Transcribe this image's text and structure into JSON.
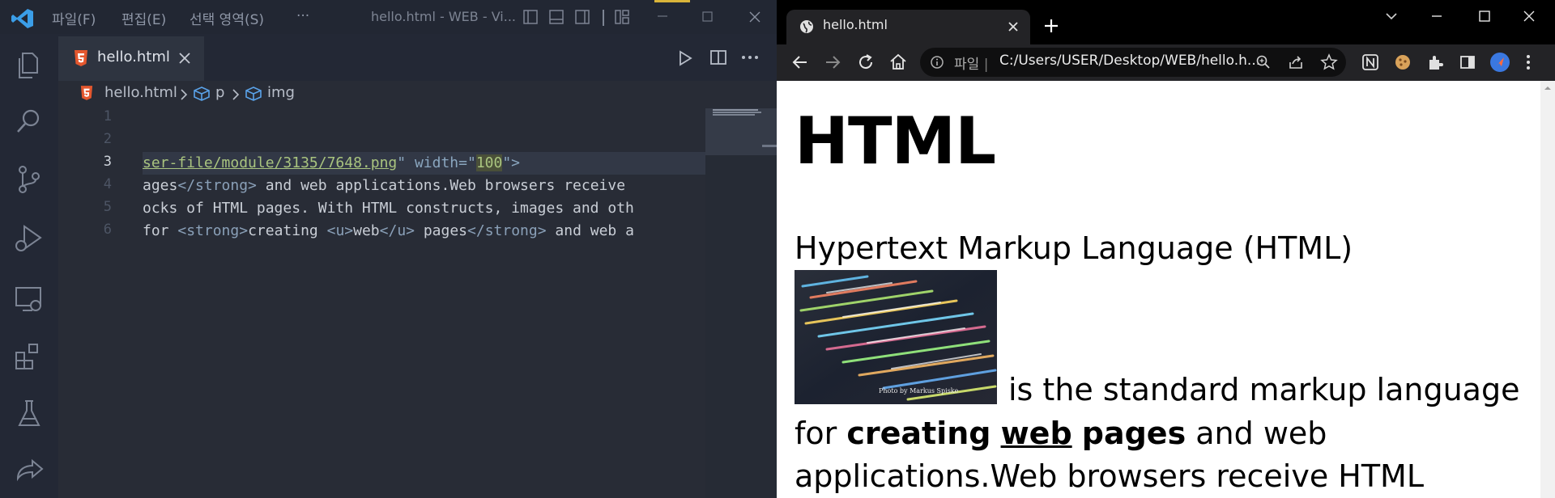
{
  "vscode": {
    "menu": [
      "파일(F)",
      "편집(E)",
      "선택 영역(S)",
      "···"
    ],
    "window_title": "hello.html - WEB - Vi...",
    "tab": {
      "label": "hello.html"
    },
    "breadcrumb": [
      "hello.html",
      "p",
      "img"
    ],
    "line_numbers": [
      "1",
      "2",
      "3",
      "4",
      "5",
      "6"
    ],
    "code": {
      "line3": {
        "src_tail": "ser-file/module/3135/7648.png",
        "attr_suffix": "\" width=\"",
        "value": "100",
        "end": "\">"
      },
      "line4": {
        "lead": "ages",
        "tag_close": "</strong>",
        "rest": " and web applications.Web browsers receive "
      },
      "line5": {
        "text": "ocks of HTML pages. With HTML constructs, images and oth"
      },
      "line6": {
        "lead": "for ",
        "tag1": "<strong>",
        "t1": "creating ",
        "tag2": "<u>",
        "t2": "web",
        "tag3": "</u>",
        "t3": " pages",
        "tag4": "</strong>",
        "t4": " and web a"
      }
    },
    "colors": {
      "accent": "#d9b43a",
      "background": "#282c36"
    }
  },
  "chrome": {
    "tab_title": "hello.html",
    "address": {
      "scheme_label": "파일",
      "separator": "|",
      "url": "C:/Users/USER/Desktop/WEB/hello.h..."
    },
    "page": {
      "heading": "HTML",
      "paragraph1": "Hypertext Markup Language (HTML)",
      "body": {
        "line1": "is the standard markup language",
        "line2_before": "for ",
        "creating": "creating",
        "web": "web",
        "pages": "pages",
        "line2_after": " and web",
        "line3": "applications.Web browsers receive HTML"
      },
      "image_caption": "Photo by Markus Spiske"
    }
  }
}
